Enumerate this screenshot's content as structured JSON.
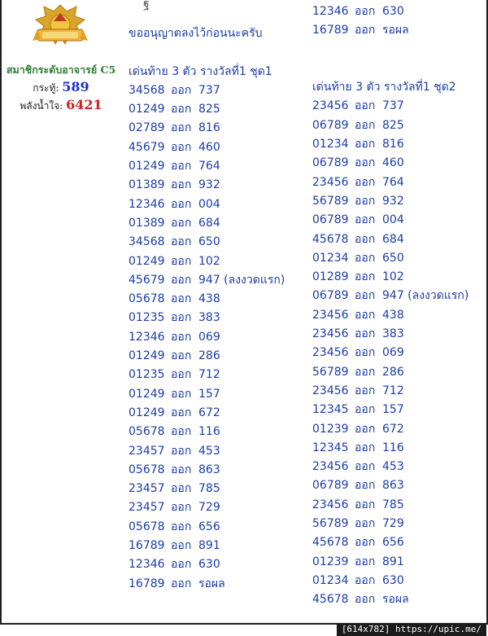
{
  "sidebar": {
    "member_title": "สมาชิกระดับอาจารย์ C5",
    "posts_label": "กระทู้:",
    "posts_value": "589",
    "power_label": "พลังน้ำใจ:",
    "power_value": "6421",
    "badge_icon": "gold-ribbon-badge-icon"
  },
  "post": {
    "top_glyph": "ฐ",
    "intro": "ขออนุญาตลงไว้ก่อนนะครับ",
    "set1_title": "เด่นท้าย 3 ตัว รางวัลที่1 ชุด1",
    "set2_title": "เด่นท้าย 3 ตัว รางวัลที่1 ชุด2",
    "out_word": "ออก",
    "set2_top": [
      {
        "digits": "12346",
        "result": "630"
      },
      {
        "digits": "16789",
        "result": "รอผล"
      }
    ],
    "set1": [
      {
        "digits": "34568",
        "result": "737"
      },
      {
        "digits": "01249",
        "result": "825"
      },
      {
        "digits": "02789",
        "result": "816"
      },
      {
        "digits": "45679",
        "result": "460"
      },
      {
        "digits": "01249",
        "result": "764"
      },
      {
        "digits": "01389",
        "result": "932"
      },
      {
        "digits": "12346",
        "result": "004"
      },
      {
        "digits": "01389",
        "result": "684"
      },
      {
        "digits": "34568",
        "result": "650"
      },
      {
        "digits": "01249",
        "result": "102"
      },
      {
        "digits": "45679",
        "result": "947 (ลงงวดแรก)"
      },
      {
        "digits": "05678",
        "result": "438"
      },
      {
        "digits": "01235",
        "result": "383"
      },
      {
        "digits": "12346",
        "result": "069"
      },
      {
        "digits": "01249",
        "result": "286"
      },
      {
        "digits": "01235",
        "result": "712"
      },
      {
        "digits": "01249",
        "result": "157"
      },
      {
        "digits": "01249",
        "result": "672"
      },
      {
        "digits": "05678",
        "result": "116"
      },
      {
        "digits": "23457",
        "result": "453"
      },
      {
        "digits": "05678",
        "result": "863"
      },
      {
        "digits": "23457",
        "result": "785"
      },
      {
        "digits": "23457",
        "result": "729"
      },
      {
        "digits": "05678",
        "result": "656"
      },
      {
        "digits": "16789",
        "result": "891"
      },
      {
        "digits": "12346",
        "result": "630"
      },
      {
        "digits": "16789",
        "result": "รอผล"
      }
    ],
    "set2": [
      {
        "digits": "23456",
        "result": "737"
      },
      {
        "digits": "06789",
        "result": "825"
      },
      {
        "digits": "01234",
        "result": "816"
      },
      {
        "digits": "06789",
        "result": "460"
      },
      {
        "digits": "23456",
        "result": "764"
      },
      {
        "digits": "56789",
        "result": "932"
      },
      {
        "digits": "06789",
        "result": "004"
      },
      {
        "digits": "45678",
        "result": "684"
      },
      {
        "digits": "01234",
        "result": "650"
      },
      {
        "digits": "01289",
        "result": "102"
      },
      {
        "digits": "06789",
        "result": "947 (ลงงวดแรก)"
      },
      {
        "digits": "23456",
        "result": "438"
      },
      {
        "digits": "23456",
        "result": "383"
      },
      {
        "digits": "23456",
        "result": "069"
      },
      {
        "digits": "56789",
        "result": "286"
      },
      {
        "digits": "23456",
        "result": "712"
      },
      {
        "digits": "12345",
        "result": "157"
      },
      {
        "digits": "01239",
        "result": "672"
      },
      {
        "digits": "12345",
        "result": "116"
      },
      {
        "digits": "23456",
        "result": "453"
      },
      {
        "digits": "06789",
        "result": "863"
      },
      {
        "digits": "23456",
        "result": "785"
      },
      {
        "digits": "56789",
        "result": "729"
      },
      {
        "digits": "45678",
        "result": "656"
      },
      {
        "digits": "01239",
        "result": "891"
      },
      {
        "digits": "01234",
        "result": "630"
      },
      {
        "digits": "45678",
        "result": "รอผล"
      }
    ]
  },
  "footer": {
    "text": "[614x782] https://upic.me/"
  }
}
